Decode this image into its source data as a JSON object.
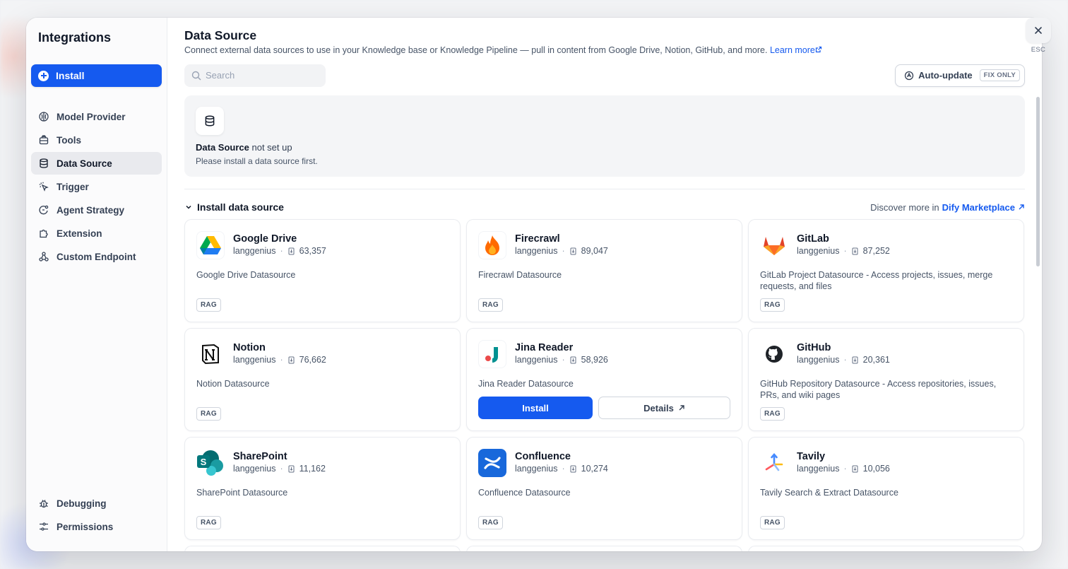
{
  "sidebar": {
    "title": "Integrations",
    "install_label": "Install",
    "items": [
      {
        "label": "Model Provider",
        "icon": "brain-icon"
      },
      {
        "label": "Tools",
        "icon": "toolbox-icon"
      },
      {
        "label": "Data Source",
        "icon": "database-icon",
        "active": true
      },
      {
        "label": "Trigger",
        "icon": "trigger-icon"
      },
      {
        "label": "Agent Strategy",
        "icon": "agent-icon"
      },
      {
        "label": "Extension",
        "icon": "puzzle-icon"
      },
      {
        "label": "Custom Endpoint",
        "icon": "endpoint-icon"
      }
    ],
    "bottom": [
      {
        "label": "Debugging",
        "icon": "bug-icon"
      },
      {
        "label": "Permissions",
        "icon": "sliders-icon"
      }
    ]
  },
  "header": {
    "title": "Data Source",
    "description": "Connect external data sources to use in your Knowledge base or Knowledge Pipeline — pull in content from Google Drive, Notion, GitHub, and more.",
    "learn_more": "Learn more"
  },
  "toolbar": {
    "search_placeholder": "Search",
    "auto_update_label": "Auto-update",
    "auto_update_badge": "FIX ONLY"
  },
  "empty": {
    "title_bold": "Data Source",
    "title_rest": " not set up",
    "subtitle": "Please install a data source first."
  },
  "section": {
    "title": "Install data source",
    "discover_prefix": "Discover more in",
    "discover_link": "Dify Marketplace"
  },
  "cards": [
    {
      "name": "Google Drive",
      "author": "langgenius",
      "installs": "63,357",
      "desc": "Google Drive Datasource",
      "tag": "RAG",
      "logo": "google-drive-logo"
    },
    {
      "name": "Firecrawl",
      "author": "langgenius",
      "installs": "89,047",
      "desc": "Firecrawl Datasource",
      "tag": "RAG",
      "logo": "firecrawl-logo"
    },
    {
      "name": "GitLab",
      "author": "langgenius",
      "installs": "87,252",
      "desc": "GitLab Project Datasource - Access projects, issues, merge requests, and files",
      "tag": "RAG",
      "logo": "gitlab-logo"
    },
    {
      "name": "Notion",
      "author": "langgenius",
      "installs": "76,662",
      "desc": "Notion Datasource",
      "tag": "RAG",
      "logo": "notion-logo"
    },
    {
      "name": "Jina Reader",
      "author": "langgenius",
      "installs": "58,926",
      "desc": "Jina Reader Datasource",
      "install_label": "Install",
      "details_label": "Details",
      "logo": "jina-logo"
    },
    {
      "name": "GitHub",
      "author": "langgenius",
      "installs": "20,361",
      "desc": "GitHub Repository Datasource - Access repositories, issues, PRs, and wiki pages",
      "tag": "RAG",
      "logo": "github-logo"
    },
    {
      "name": "SharePoint",
      "author": "langgenius",
      "installs": "11,162",
      "desc": "SharePoint Datasource",
      "tag": "RAG",
      "logo": "sharepoint-logo"
    },
    {
      "name": "Confluence",
      "author": "langgenius",
      "installs": "10,274",
      "desc": "Confluence Datasource",
      "tag": "RAG",
      "logo": "confluence-logo"
    },
    {
      "name": "Tavily",
      "author": "langgenius",
      "installs": "10,056",
      "desc": "Tavily Search & Extract Datasource",
      "tag": "RAG",
      "logo": "tavily-logo"
    }
  ],
  "close": {
    "esc_label": "ESC"
  },
  "colors": {
    "accent": "#155aef",
    "active_nav": "#e9eaee"
  }
}
